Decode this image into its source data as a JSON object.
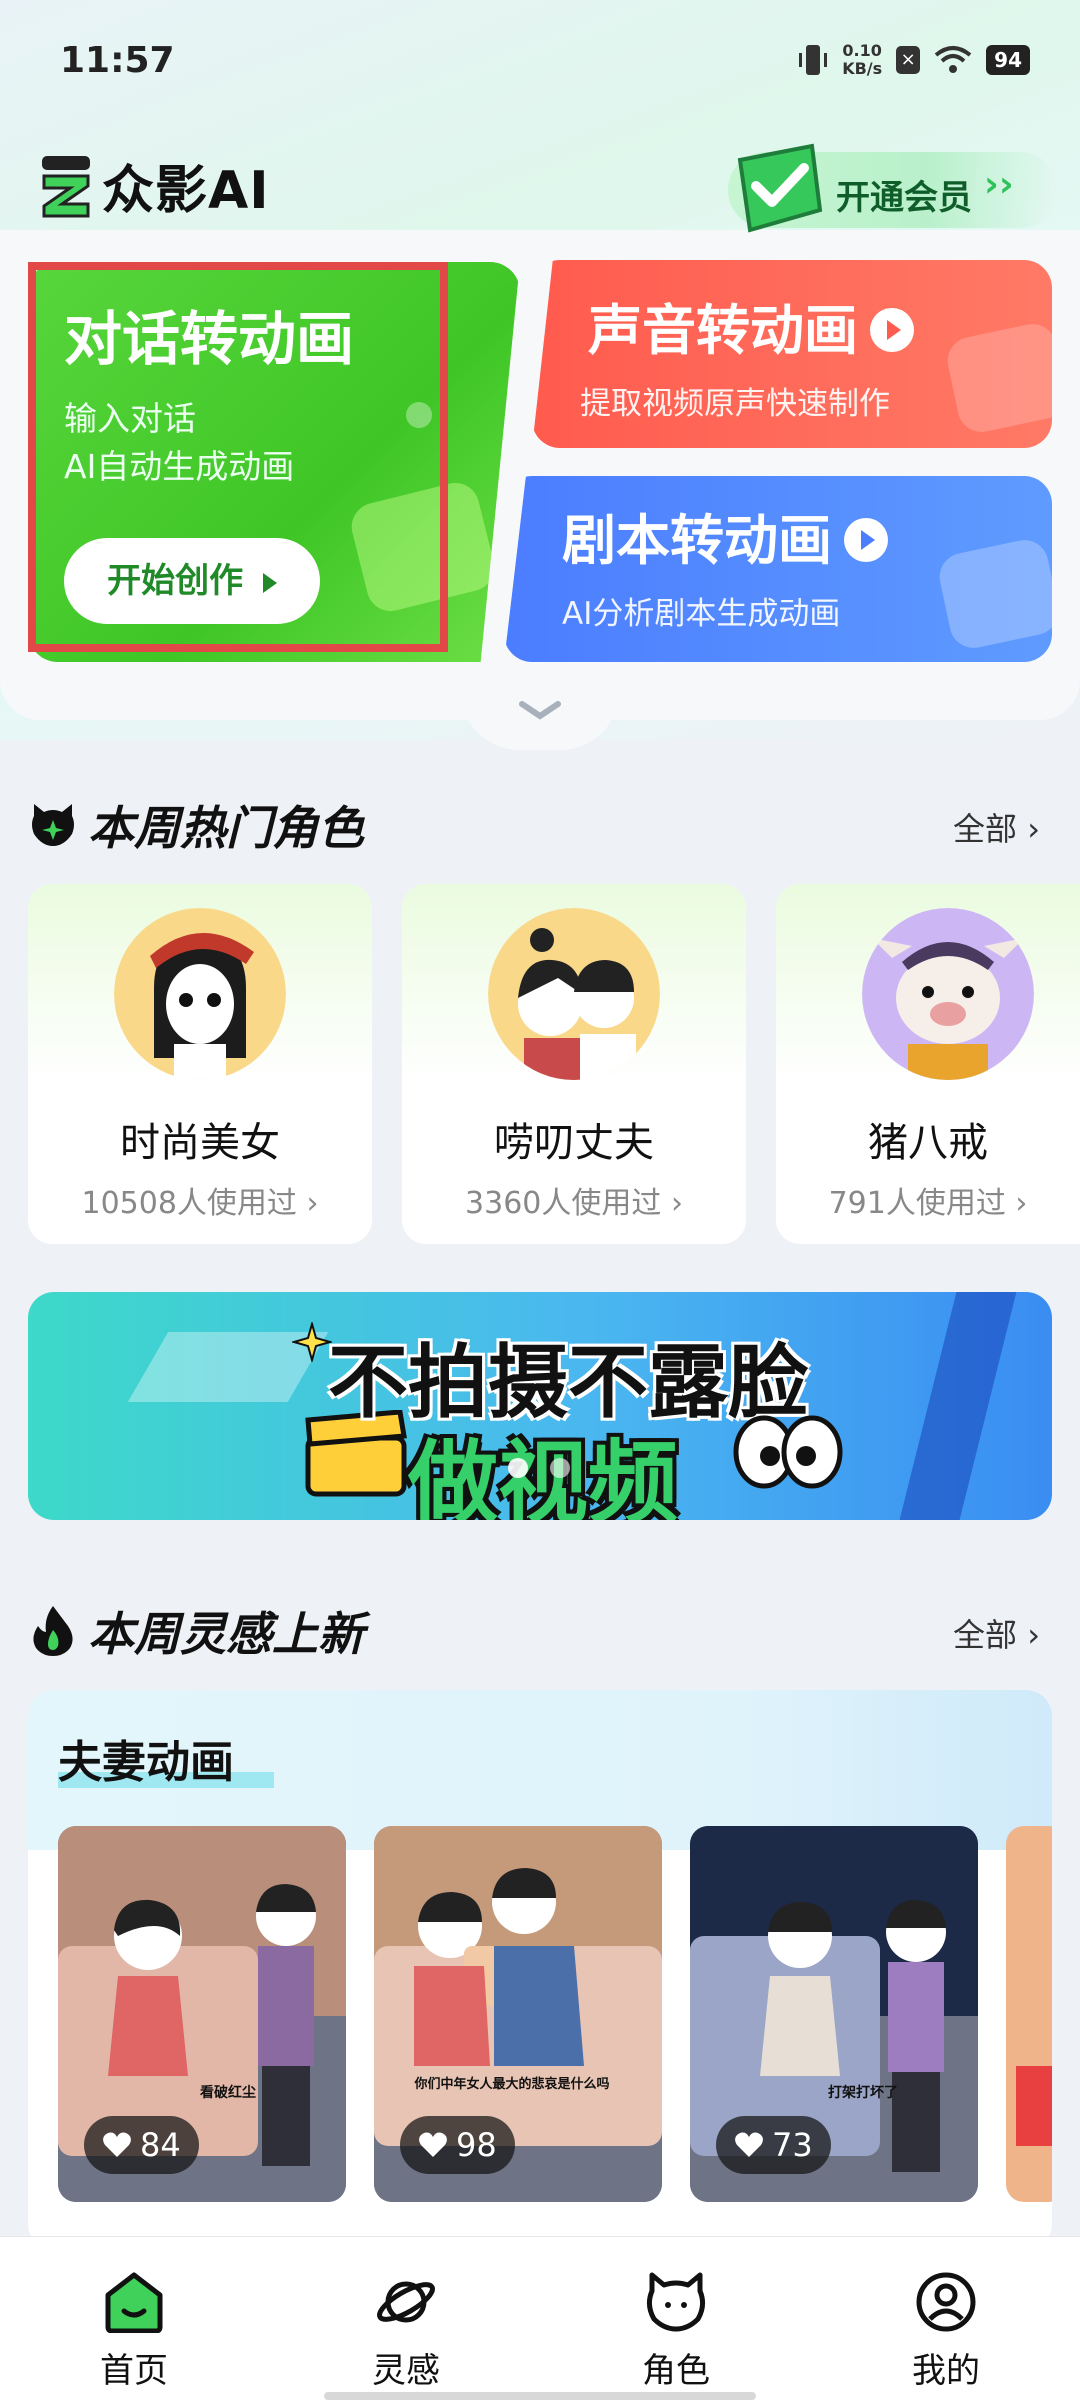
{
  "status_bar": {
    "time": "11:57",
    "speed_value": "0.10",
    "speed_unit": "KB/s",
    "battery": "94"
  },
  "header": {
    "logo_text": "众影AI",
    "vip_label": "开通会员"
  },
  "features": {
    "dialogue": {
      "title": "对话转动画",
      "line1": "输入对话",
      "line2": "AI自动生成动画",
      "button": "开始创作"
    },
    "voice": {
      "title": "声音转动画",
      "subtitle": "提取视频原声快速制作"
    },
    "script": {
      "title": "剧本转动画",
      "subtitle": "AI分析剧本生成动画"
    }
  },
  "hot_characters": {
    "title": "本周热门角色",
    "more": "全部",
    "items": [
      {
        "name": "时尚美女",
        "count": "10508人使用过"
      },
      {
        "name": "唠叨丈夫",
        "count": "3360人使用过"
      },
      {
        "name": "猪八戒",
        "count": "791人使用过"
      }
    ]
  },
  "banner": {
    "line1": "不拍摄不露脸",
    "line2": "做视频"
  },
  "inspiration": {
    "title": "本周灵感上新",
    "more": "全部",
    "category": "夫妻动画",
    "videos": [
      {
        "likes": "84",
        "subtitle": "看破红尘"
      },
      {
        "likes": "98",
        "subtitle": "你们中年女人最大的悲哀是什么吗"
      },
      {
        "likes": "73",
        "subtitle": "打架打坏了"
      }
    ]
  },
  "nav": {
    "home": "首页",
    "inspiration": "灵感",
    "role": "角色",
    "mine": "我的"
  },
  "colors": {
    "accent_green": "#3fc626",
    "card_red": "#ff5b4e",
    "card_blue": "#4b7dff"
  }
}
